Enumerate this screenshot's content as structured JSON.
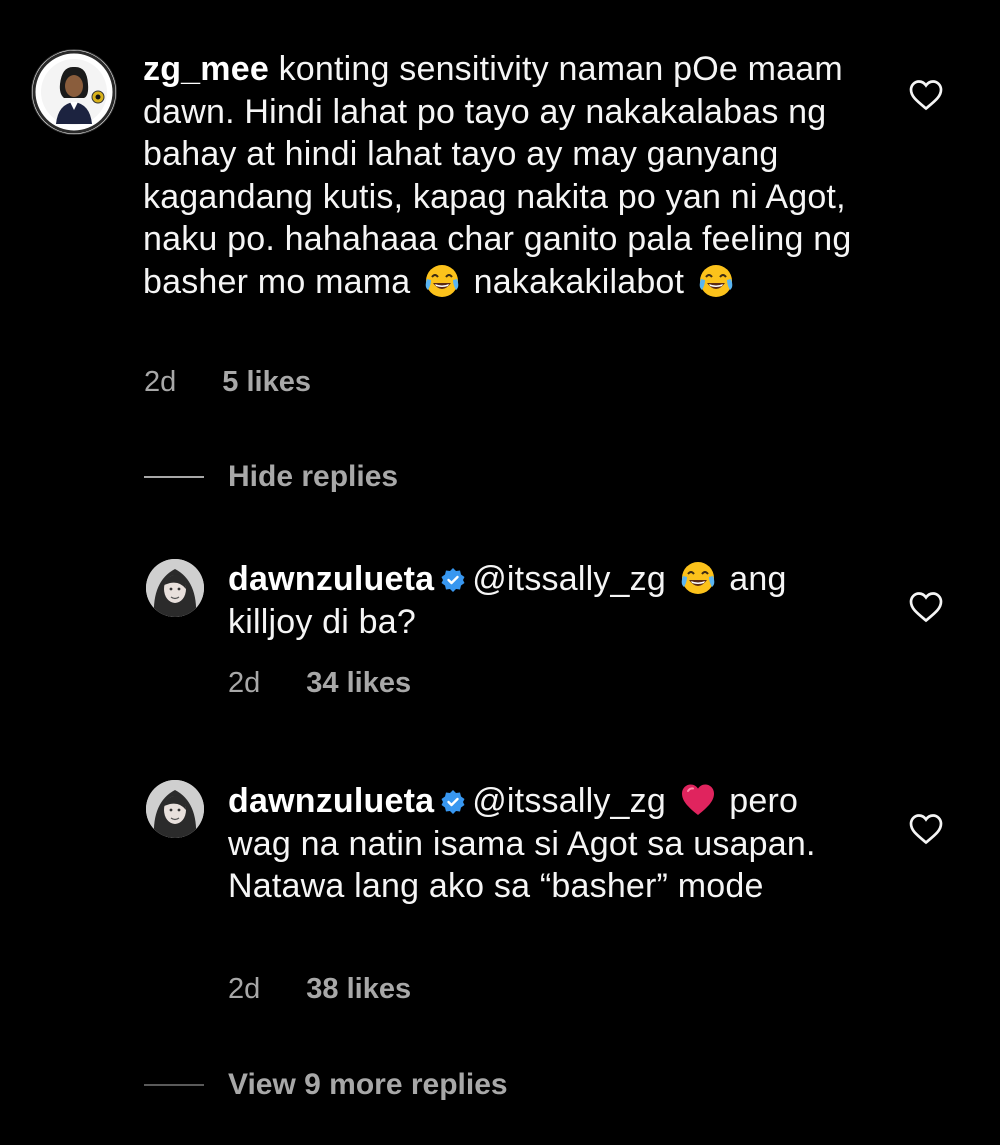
{
  "comment": {
    "username": "zg_mee",
    "text": " konting sensitivity naman pOe maam dawn. Hindi lahat po tayo ay nakakalabas ng bahay at hindi lahat tayo ay may ganyang kagandang kutis, kapag nakita po yan ni Agot, naku po. hahahaaa char ganito pala feeling ng basher mo mama",
    "text_after_emoji": " nakakakilabot",
    "emoji": "face-with-tears-of-joy",
    "time": "2d",
    "likes": "5 likes"
  },
  "hide_replies_label": "Hide replies",
  "replies": [
    {
      "username": "dawnzulueta",
      "mention": "@itssally_zg",
      "emoji": "face-with-tears-of-joy",
      "text": " ang killjoy di ba?",
      "time": "2d",
      "likes": "34 likes"
    },
    {
      "username": "dawnzulueta",
      "mention": "@itssally_zg",
      "emoji": "red-heart",
      "text": " pero wag na natin isama si Agot sa usapan. Natawa lang ako sa “basher” mode",
      "time": "2d",
      "likes": "38 likes"
    }
  ],
  "view_more_label": "View 9 more replies",
  "colors": {
    "background": "#000000",
    "text": "#f5f5f5",
    "meta": "#a8a8a8",
    "verified": "#3897f0",
    "heart_emoji": "#e0245e"
  }
}
